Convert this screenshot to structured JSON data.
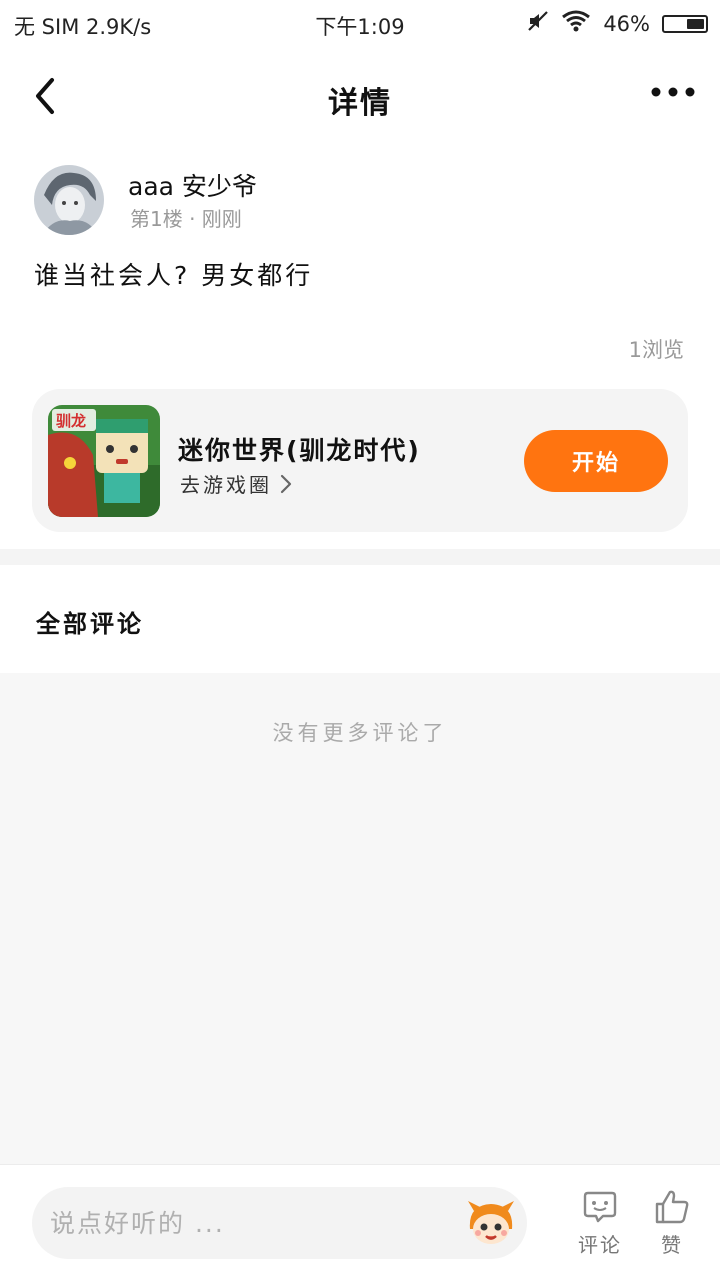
{
  "status_bar": {
    "carrier": "无 SIM 2.9K/s",
    "time": "下午1:09",
    "battery": "46%",
    "battery_level": 0.46
  },
  "nav": {
    "title": "详情"
  },
  "post": {
    "author_name": "aaa 安少爷",
    "floor": "第1楼",
    "time": "· 刚刚",
    "content": "谁当社会人? 男女都行",
    "views": "1浏览"
  },
  "game_card": {
    "name": "迷你世界(驯龙时代)",
    "link_label": "去游戏圈",
    "start_label": "开始",
    "icon_text": "驯龙",
    "accent_color": "#ff7410"
  },
  "comments": {
    "heading": "全部评论",
    "empty_text": "没有更多评论了"
  },
  "bottom_bar": {
    "input_placeholder": "说点好听的 ...",
    "comment_label": "评论",
    "like_label": "赞"
  }
}
